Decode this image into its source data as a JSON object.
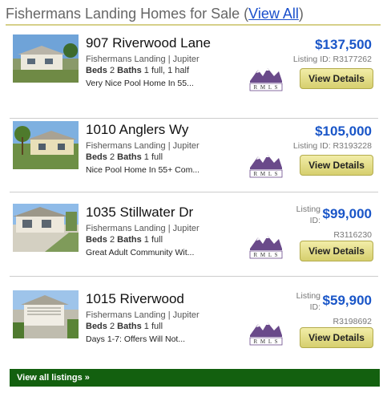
{
  "header": {
    "title": "Fishermans Landing Homes for Sale (",
    "view_all": "View All",
    "close_paren": ")"
  },
  "listings": [
    {
      "address": "907 Riverwood Lane",
      "subdivision": "Fishermans Landing | Jupiter",
      "beds_label": "Beds",
      "beds": "2",
      "baths_label": "Baths",
      "baths": "1 full, 1 half",
      "description": "Very Nice Pool Home In 55...",
      "price": "$137,500",
      "listing_id": "Listing ID: R3177262",
      "button": "View Details",
      "badge": "RMLS"
    },
    {
      "address": "1010 Anglers Wy",
      "subdivision": "Fishermans Landing | Jupiter",
      "beds_label": "Beds",
      "beds": "2",
      "baths_label": "Baths",
      "baths": "1 full",
      "description": "Nice Pool Home In 55+ Com...",
      "price": "$105,000",
      "listing_id": "Listing ID: R3193228",
      "button": "View Details",
      "badge": "RMLS"
    },
    {
      "address": "1035 Stillwater Dr",
      "subdivision": "Fishermans Landing | Jupiter",
      "beds_label": "Beds",
      "beds": "2",
      "baths_label": "Baths",
      "baths": "1 full",
      "description": "Great Adult Community Wit...",
      "price": "$99,000",
      "listing_id_label": "Listing ID:",
      "listing_id_num": "R3116230",
      "button": "View Details",
      "badge": "RMLS"
    },
    {
      "address": "1015 Riverwood",
      "subdivision": "Fishermans Landing | Jupiter",
      "beds_label": "Beds",
      "beds": "2",
      "baths_label": "Baths",
      "baths": "1 full",
      "description": "Days 1-7: Offers Will Not...",
      "price": "$59,900",
      "listing_id_label": "Listing ID:",
      "listing_id_num": "R3198692",
      "button": "View Details",
      "badge": "RMLS"
    }
  ],
  "footer": {
    "label": "View all listings »"
  },
  "colors": {
    "price": "#1a56c8",
    "button": "#e4dc86",
    "footer": "#13600f",
    "header_rule": "#d6d08a"
  }
}
